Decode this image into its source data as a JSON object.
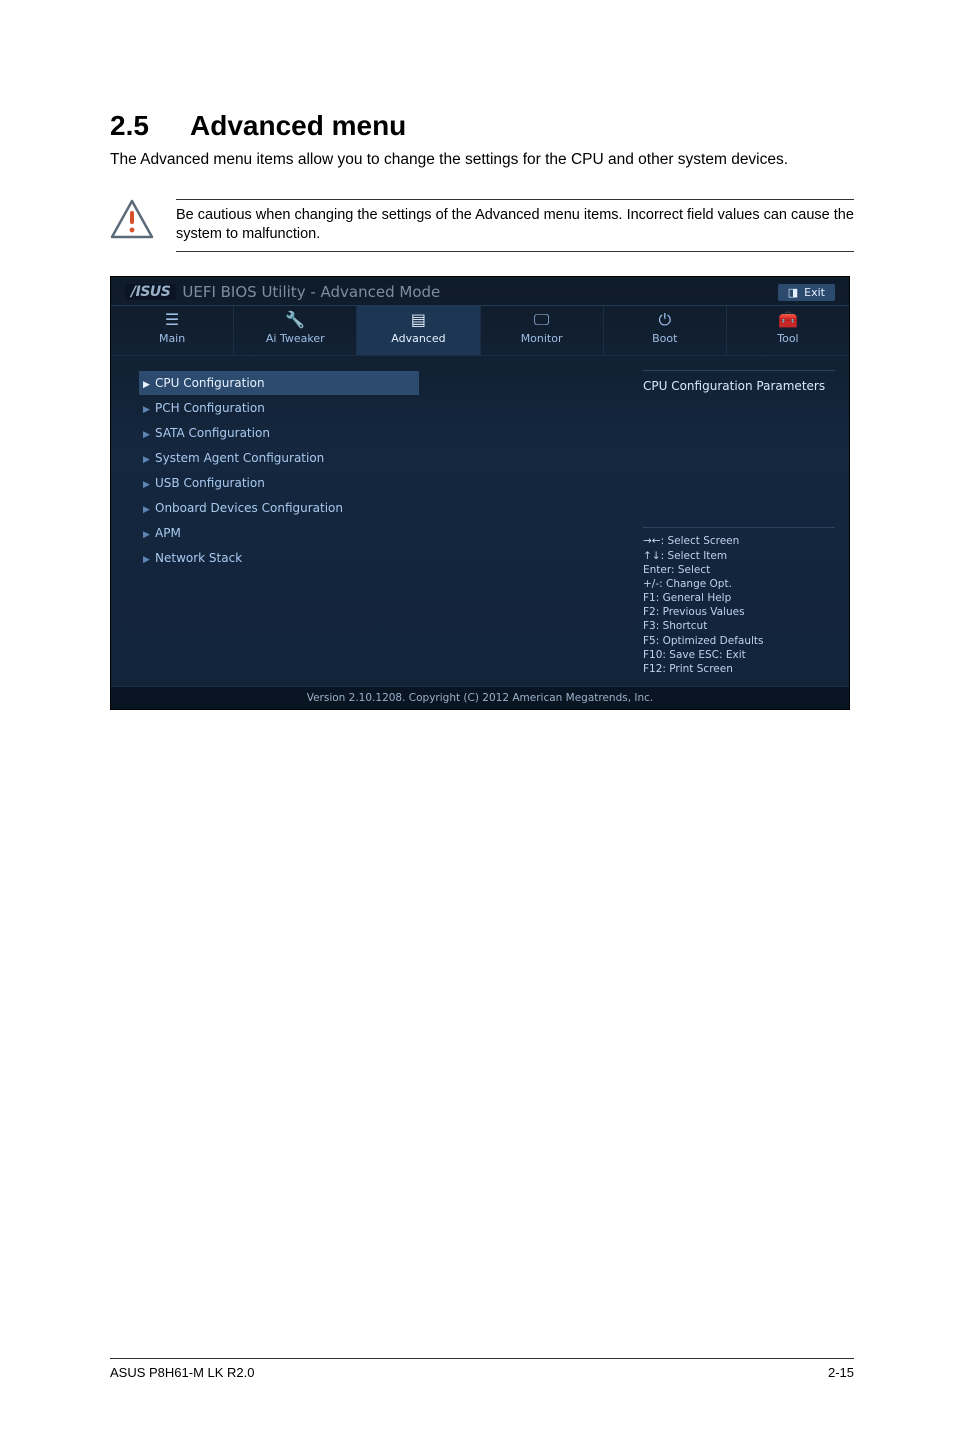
{
  "heading": {
    "num": "2.5",
    "title": "Advanced menu"
  },
  "intro": "The Advanced menu items allow you to change the settings for the CPU and other system devices.",
  "caution": "Be cautious when changing the settings of the Advanced menu items. Incorrect field values can cause the system to malfunction.",
  "bios": {
    "titlebar": {
      "logo": "/ISUS",
      "title": "UEFI BIOS Utility - Advanced Mode",
      "exit": "Exit"
    },
    "tabs": {
      "main": {
        "label": "Main"
      },
      "tweaker": {
        "label": "Ai Tweaker"
      },
      "advanced": {
        "label": "Advanced"
      },
      "monitor": {
        "label": "Monitor"
      },
      "boot": {
        "label": "Boot"
      },
      "tool": {
        "label": "Tool"
      }
    },
    "menu": {
      "cpu": "CPU Configuration",
      "pch": "PCH Configuration",
      "sata": "SATA Configuration",
      "agent": "System Agent Configuration",
      "usb": "USB Configuration",
      "onboard": "Onboard Devices Configuration",
      "apm": "APM",
      "net": "Network Stack"
    },
    "help_title": "CPU Configuration Parameters",
    "keys": {
      "k0": "→←: Select Screen",
      "k1": "↑↓: Select Item",
      "k2": "Enter: Select",
      "k3": "+/-: Change Opt.",
      "k4": "F1: General Help",
      "k5": "F2: Previous Values",
      "k6": "F3: Shortcut",
      "k7": "F5: Optimized Defaults",
      "k8": "F10: Save  ESC: Exit",
      "k9": "F12: Print Screen"
    },
    "footer": "Version 2.10.1208. Copyright (C) 2012 American Megatrends, Inc."
  },
  "page_footer": {
    "left": "ASUS P8H61-M LK R2.0",
    "right": "2-15"
  }
}
